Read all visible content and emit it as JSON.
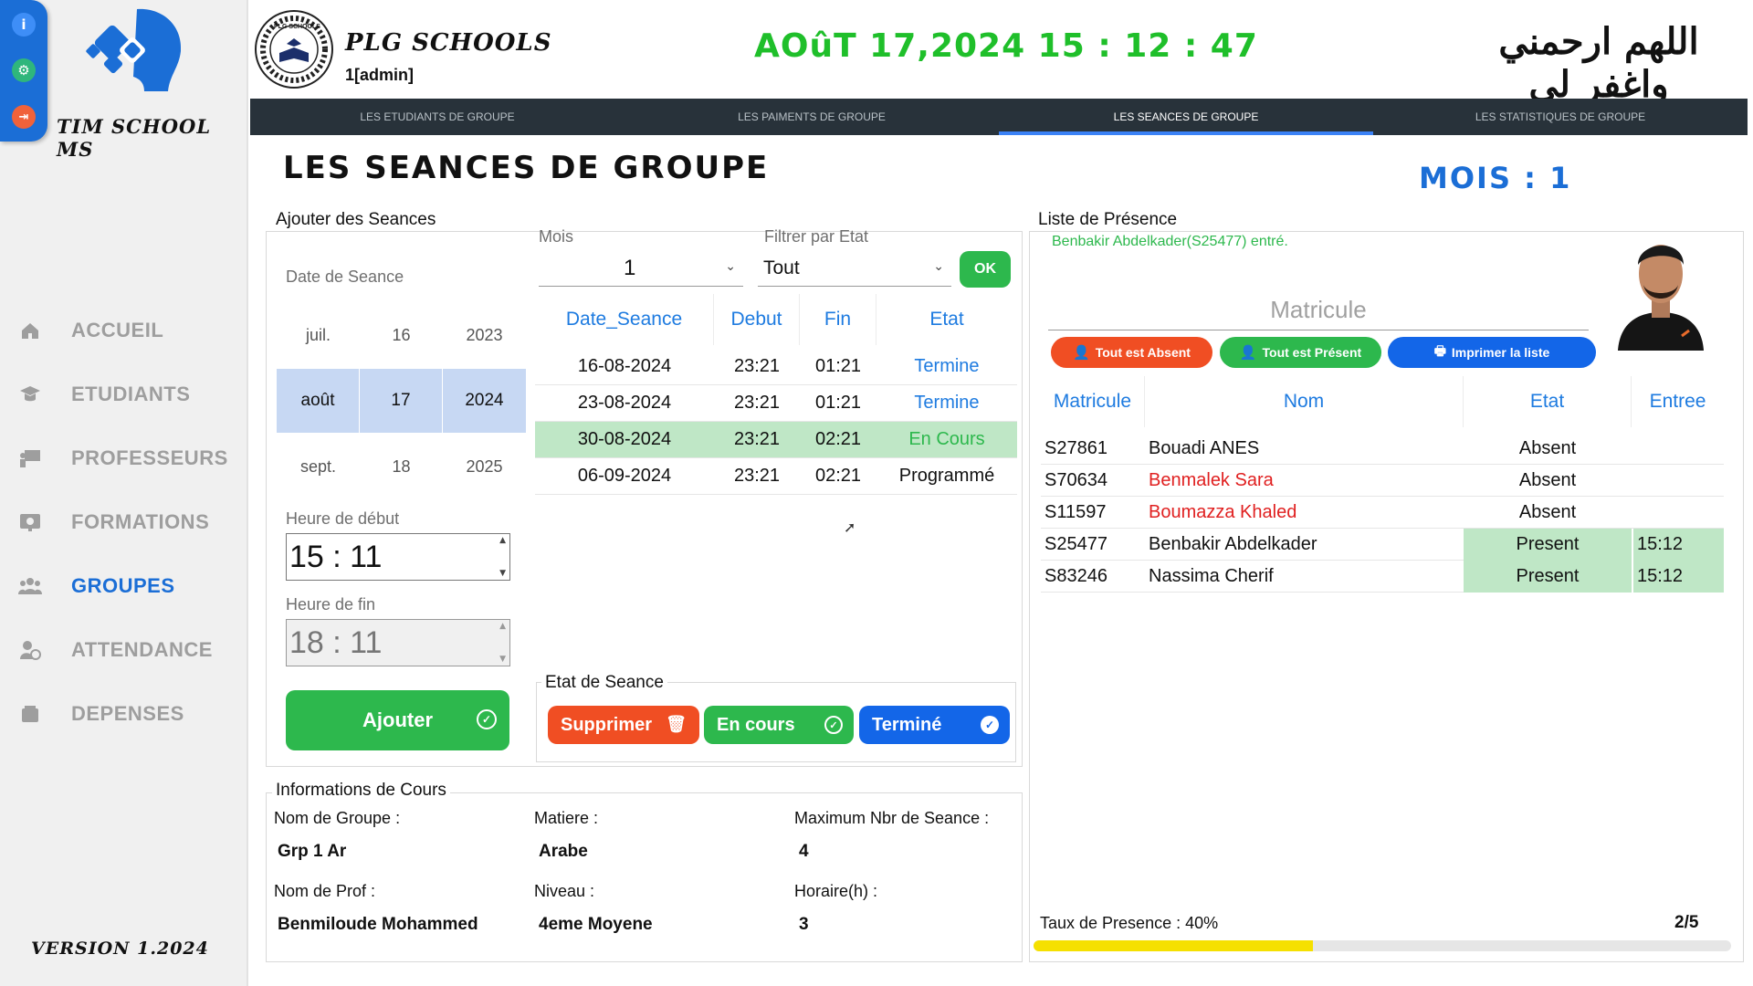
{
  "app": {
    "brand": "TIM SCHOOL MS",
    "version": "VERSION 1.2024"
  },
  "mini_toolbar": {
    "info_icon": "info-icon",
    "settings_icon": "gear-icon",
    "logout_icon": "logout-icon"
  },
  "sidebar": {
    "items": [
      {
        "label": "ACCUEIL",
        "icon": "home-icon",
        "active": false
      },
      {
        "label": "ETUDIANTS",
        "icon": "graduation-cap-icon",
        "active": false
      },
      {
        "label": "PROFESSEURS",
        "icon": "teacher-board-icon",
        "active": false
      },
      {
        "label": "FORMATIONS",
        "icon": "certificate-icon",
        "active": false
      },
      {
        "label": "GROUPES",
        "icon": "users-group-icon",
        "active": true
      },
      {
        "label": "ATTENDANCE",
        "icon": "user-clock-icon",
        "active": false
      },
      {
        "label": "DEPENSES",
        "icon": "wallet-icon",
        "active": false
      }
    ]
  },
  "header": {
    "school_name": "PLG SCHOOLS",
    "user": "1[admin]",
    "datetime": "AOûT 17,2024 15 : 12 : 47",
    "arabic_text": "اللهم ارحمني واغفر لي",
    "logo_text": "PLG SCHOOLS"
  },
  "tabs": [
    {
      "label": "LES ETUDIANTS DE GROUPE",
      "active": false
    },
    {
      "label": "LES PAIMENTS DE GROUPE",
      "active": false
    },
    {
      "label": "LES SEANCES DE GROUPE",
      "active": true
    },
    {
      "label": "LES STATISTIQUES DE GROUPE",
      "active": false
    }
  ],
  "page": {
    "title": "LES SEANCES DE GROUPE",
    "mois_label": "MOIS : 1"
  },
  "ajouter": {
    "title": "Ajouter des Seances",
    "date_label": "Date de Seance",
    "picker": {
      "months": [
        "juil.",
        "août",
        "sept."
      ],
      "days": [
        "16",
        "17",
        "18"
      ],
      "years": [
        "2023",
        "2024",
        "2025"
      ]
    },
    "heure_debut_label": "Heure de début",
    "heure_debut": "15 : 11",
    "heure_fin_label": "Heure de fin",
    "heure_fin": "18 : 11",
    "ajouter_btn": "Ajouter"
  },
  "filters": {
    "mois_label": "Mois",
    "mois_value": "1",
    "etat_label": "Filtrer par Etat",
    "etat_value": "Tout",
    "ok_btn": "OK"
  },
  "seances_table": {
    "headers": [
      "Date_Seance",
      "Debut",
      "Fin",
      "Etat"
    ],
    "rows": [
      {
        "date": "16-08-2024",
        "debut": "23:21",
        "fin": "01:21",
        "etat": "Termine",
        "state": "termine"
      },
      {
        "date": "23-08-2024",
        "debut": "23:21",
        "fin": "01:21",
        "etat": "Termine",
        "state": "termine"
      },
      {
        "date": "30-08-2024",
        "debut": "23:21",
        "fin": "02:21",
        "etat": "En Cours",
        "state": "encours"
      },
      {
        "date": "06-09-2024",
        "debut": "23:21",
        "fin": "02:21",
        "etat": "Programmé",
        "state": "programme"
      }
    ]
  },
  "etat_seance": {
    "title": "Etat de Seance",
    "supprimer": "Supprimer",
    "en_cours": "En cours",
    "termine": "Terminé"
  },
  "info_cours": {
    "title": "Informations de Cours",
    "nom_groupe_label": "Nom de Groupe :",
    "nom_groupe": "Grp 1 Ar",
    "matiere_label": "Matiere :",
    "matiere": "Arabe",
    "max_label": "Maximum Nbr de Seance :",
    "max": "4",
    "prof_label": "Nom de Prof :",
    "prof": "Benmiloude Mohammed",
    "niveau_label": "Niveau :",
    "niveau": "4eme Moyene",
    "horaire_label": "Horaire(h) :",
    "horaire": "3"
  },
  "presence": {
    "title": "Liste de Présence",
    "message": "Benbakir Abdelkader(S25477) entré.",
    "matricule_placeholder": "Matricule",
    "tout_absent": "Tout est Absent",
    "tout_present": "Tout est Présent",
    "imprimer": "Imprimer la liste",
    "headers": [
      "Matricule",
      "Nom",
      "Etat",
      "Entree"
    ],
    "rows": [
      {
        "matricule": "S27861",
        "nom": "Bouadi ANES",
        "etat": "Absent",
        "entree": "",
        "nom_color": "#111111",
        "present": false
      },
      {
        "matricule": "S70634",
        "nom": "Benmalek Sara",
        "etat": "Absent",
        "entree": "",
        "nom_color": "#e02020",
        "present": false
      },
      {
        "matricule": "S11597",
        "nom": "Boumazza Khaled",
        "etat": "Absent",
        "entree": "",
        "nom_color": "#e02020",
        "present": false
      },
      {
        "matricule": "S25477",
        "nom": "Benbakir Abdelkader",
        "etat": "Present",
        "entree": "15:12",
        "nom_color": "#111111",
        "present": true
      },
      {
        "matricule": "S83246",
        "nom": "Nassima Cherif",
        "etat": "Present",
        "entree": "15:12",
        "nom_color": "#111111",
        "present": true
      }
    ],
    "taux_label": "Taux de Presence : 40%",
    "ratio": "2/5",
    "progress_fraction": 0.4
  },
  "colors": {
    "accent": "#1b6ed6",
    "green": "#2db84d",
    "header_green": "#1fbf2a",
    "red": "#f04e23",
    "blue": "#1366e8",
    "dark": "#28323a",
    "progress": "#f5e000"
  }
}
